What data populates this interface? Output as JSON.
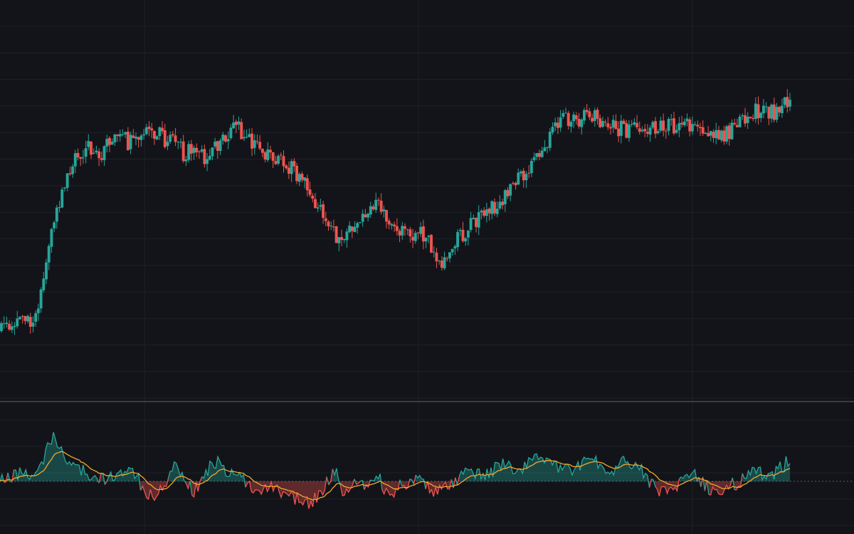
{
  "colors": {
    "background": "#131419",
    "grid": "#1f2127",
    "separator": "#3a3c42",
    "zero_line": "#5b5e66",
    "up": "#26a69a",
    "down": "#ef5350",
    "signal": "#f0a82e"
  },
  "chart_data": [
    {
      "type": "candlestick",
      "title": "",
      "xlabel": "",
      "ylabel": "",
      "grid": true,
      "ylim": [
        0,
        100
      ],
      "bars": 300,
      "anchors": [
        [
          0,
          15
        ],
        [
          10,
          19
        ],
        [
          16,
          17
        ],
        [
          20,
          27
        ],
        [
          30,
          55
        ],
        [
          40,
          65
        ],
        [
          50,
          64
        ],
        [
          58,
          68
        ],
        [
          65,
          66
        ],
        [
          75,
          70
        ],
        [
          90,
          64
        ],
        [
          100,
          63
        ],
        [
          115,
          71
        ],
        [
          128,
          65
        ],
        [
          140,
          60
        ],
        [
          150,
          57
        ],
        [
          155,
          51
        ],
        [
          165,
          41
        ],
        [
          175,
          43
        ],
        [
          185,
          50
        ],
        [
          200,
          40
        ],
        [
          210,
          42
        ],
        [
          215,
          32
        ],
        [
          230,
          43
        ],
        [
          240,
          47
        ],
        [
          260,
          59
        ],
        [
          275,
          72
        ],
        [
          290,
          74
        ],
        [
          305,
          70
        ],
        [
          320,
          71
        ],
        [
          340,
          71
        ],
        [
          360,
          69
        ],
        [
          375,
          76
        ],
        [
          382,
          75
        ],
        [
          390,
          79
        ]
      ]
    },
    {
      "type": "area",
      "title": "",
      "series": [
        {
          "role": "oscillator"
        },
        {
          "role": "signal"
        }
      ],
      "ylim": [
        -1,
        1
      ],
      "baseline": 0,
      "anchors": [
        [
          0,
          0.05
        ],
        [
          7,
          0.15
        ],
        [
          14,
          0.1
        ],
        [
          18,
          0.45
        ],
        [
          22,
          0.95
        ],
        [
          26,
          0.5
        ],
        [
          30,
          0.3
        ],
        [
          38,
          0.1
        ],
        [
          45,
          0.05
        ],
        [
          55,
          0.15
        ],
        [
          62,
          -0.3
        ],
        [
          68,
          -0.1
        ],
        [
          72,
          0.35
        ],
        [
          76,
          0.05
        ],
        [
          80,
          -0.2
        ],
        [
          88,
          0.4
        ],
        [
          96,
          0.15
        ],
        [
          104,
          -0.1
        ],
        [
          112,
          -0.15
        ],
        [
          120,
          -0.3
        ],
        [
          128,
          -0.4
        ],
        [
          132,
          -0.25
        ],
        [
          138,
          0.25
        ],
        [
          142,
          -0.3
        ],
        [
          146,
          0.1
        ],
        [
          150,
          -0.1
        ],
        [
          156,
          0.15
        ],
        [
          160,
          -0.3
        ],
        [
          166,
          -0.05
        ],
        [
          172,
          0.1
        ],
        [
          178,
          -0.2
        ],
        [
          186,
          -0.1
        ],
        [
          192,
          0.2
        ],
        [
          200,
          0.1
        ],
        [
          208,
          0.35
        ],
        [
          214,
          0.15
        ],
        [
          222,
          0.5
        ],
        [
          228,
          0.35
        ],
        [
          236,
          0.2
        ],
        [
          244,
          0.45
        ],
        [
          250,
          0.15
        ],
        [
          258,
          0.4
        ],
        [
          266,
          0.15
        ],
        [
          272,
          -0.25
        ],
        [
          280,
          -0.1
        ],
        [
          286,
          0.2
        ],
        [
          294,
          -0.25
        ],
        [
          300,
          -0.1
        ],
        [
          306,
          0.0
        ],
        [
          310,
          0.25
        ],
        [
          318,
          0.05
        ],
        [
          326,
          0.45
        ]
      ]
    }
  ]
}
